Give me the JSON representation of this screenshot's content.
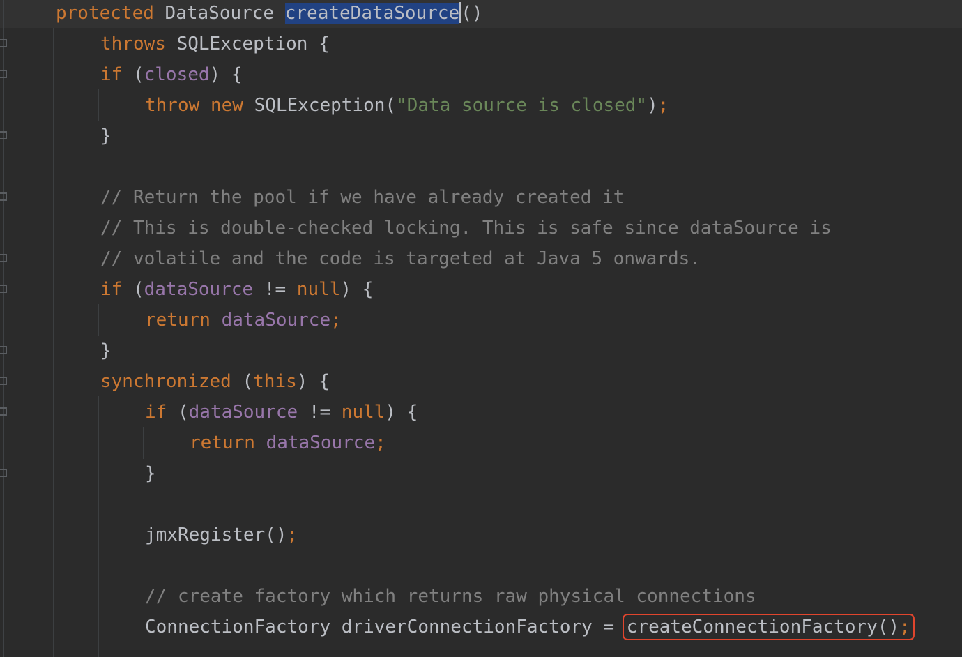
{
  "code": {
    "l1": {
      "kw": "protected",
      "type": "DataSource",
      "method": "createDataSource",
      "paren": "()"
    },
    "l2": {
      "kw": "throws",
      "rest": "SQLException {"
    },
    "l3": {
      "kw": "if",
      "open": "(",
      "fld": "closed",
      "close": ") {"
    },
    "l4": {
      "kw1": "throw",
      "kw2": "new",
      "cls": "SQLException(",
      "str": "\"Data source is closed\"",
      "close": ")",
      "semi": ";"
    },
    "l5": {
      "brace": "}"
    },
    "l6": {
      "cmt": "// Return the pool if we have already created it"
    },
    "l7": {
      "cmt": "// This is double-checked locking. This is safe since dataSource is"
    },
    "l8": {
      "cmt": "// volatile and the code is targeted at Java 5 onwards."
    },
    "l9": {
      "kw": "if",
      "open": "(",
      "fld": "dataSource",
      "op": "!=",
      "null": "null",
      "close": ") {"
    },
    "l10": {
      "kw": "return",
      "fld": "dataSource",
      "semi": ";"
    },
    "l11": {
      "brace": "}"
    },
    "l12": {
      "kw": "synchronized",
      "open": "(",
      "this": "this",
      "close": ") {"
    },
    "l13": {
      "kw": "if",
      "open": "(",
      "fld": "dataSource",
      "op": "!=",
      "null": "null",
      "close": ") {"
    },
    "l14": {
      "kw": "return",
      "fld": "dataSource",
      "semi": ";"
    },
    "l15": {
      "brace": "}"
    },
    "l16": {
      "call": "jmxRegister()",
      "semi": ";"
    },
    "l17": {
      "cmt": "// create factory which returns raw physical connections"
    },
    "l18": {
      "type": "ConnectionFactory",
      "var": "driverConnectionFactory",
      "eq": "=",
      "call": "createConnectionFactory()",
      "semi": ";"
    }
  },
  "colors": {
    "background": "#2b2b2b",
    "keyword": "#cc7832",
    "field": "#9876aa",
    "string": "#6a8759",
    "comment": "#808080",
    "selection": "#214283",
    "highlight_box": "#e0452d"
  }
}
